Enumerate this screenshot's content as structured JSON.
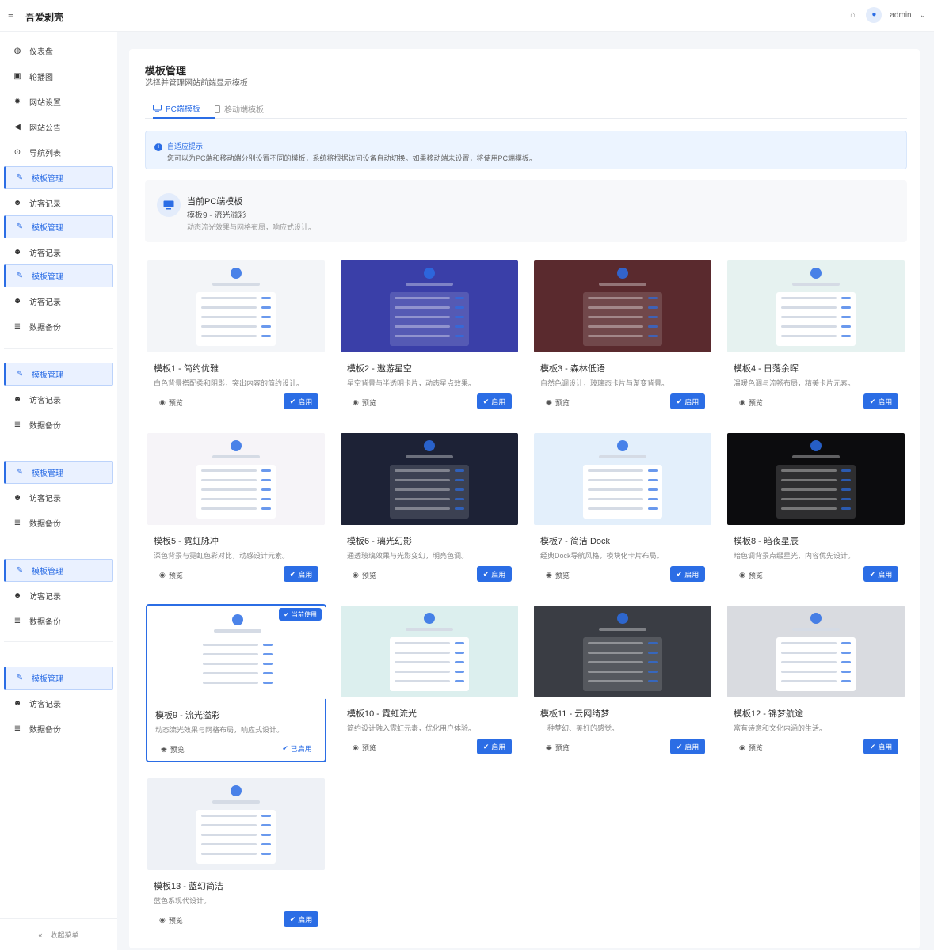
{
  "header": {
    "brand": "吾爱剥壳",
    "username": "admin",
    "caret": "⌄",
    "menu_icon": "menu-icon",
    "home_icon": "home-icon",
    "avatar_icon": "user-icon"
  },
  "sidebar": {
    "items": [
      {
        "label": "仪表盘",
        "icon": "dashboard-icon",
        "glyph": "◍",
        "active": false
      },
      {
        "label": "轮播图",
        "icon": "image-icon",
        "glyph": "▣",
        "active": false
      },
      {
        "label": "网站设置",
        "icon": "gear-icon",
        "glyph": "✹",
        "active": false
      },
      {
        "label": "网站公告",
        "icon": "megaphone-icon",
        "glyph": "◀",
        "active": false
      },
      {
        "label": "导航列表",
        "icon": "compass-icon",
        "glyph": "⊙",
        "active": false
      },
      {
        "label": "模板管理",
        "icon": "brush-icon",
        "glyph": "✎",
        "active": true
      },
      {
        "label": "访客记录",
        "icon": "users-icon",
        "glyph": "☻",
        "active": false
      },
      {
        "label": "模板管理",
        "icon": "brush-icon",
        "glyph": "✎",
        "active": true
      },
      {
        "label": "访客记录",
        "icon": "users-icon",
        "glyph": "☻",
        "active": false
      },
      {
        "label": "模板管理",
        "icon": "brush-icon",
        "glyph": "✎",
        "active": true
      },
      {
        "label": "访客记录",
        "icon": "users-icon",
        "glyph": "☻",
        "active": false
      },
      {
        "label": "数据备份",
        "icon": "database-icon",
        "glyph": "≣",
        "active": false
      },
      {
        "label": "模板管理",
        "icon": "brush-icon",
        "glyph": "✎",
        "active": true
      },
      {
        "label": "访客记录",
        "icon": "users-icon",
        "glyph": "☻",
        "active": false
      },
      {
        "label": "数据备份",
        "icon": "database-icon",
        "glyph": "≣",
        "active": false
      },
      {
        "label": "模板管理",
        "icon": "brush-icon",
        "glyph": "✎",
        "active": true
      },
      {
        "label": "访客记录",
        "icon": "users-icon",
        "glyph": "☻",
        "active": false
      },
      {
        "label": "数据备份",
        "icon": "database-icon",
        "glyph": "≣",
        "active": false
      },
      {
        "label": "模板管理",
        "icon": "brush-icon",
        "glyph": "✎",
        "active": true
      },
      {
        "label": "访客记录",
        "icon": "users-icon",
        "glyph": "☻",
        "active": false
      },
      {
        "label": "数据备份",
        "icon": "database-icon",
        "glyph": "≣",
        "active": false
      },
      {
        "label": "模板管理",
        "icon": "brush-icon",
        "glyph": "✎",
        "active": true
      },
      {
        "label": "访客记录",
        "icon": "users-icon",
        "glyph": "☻",
        "active": false
      },
      {
        "label": "数据备份",
        "icon": "database-icon",
        "glyph": "≣",
        "active": false
      }
    ],
    "collapse_icon": "«",
    "collapse_label": "收起菜单"
  },
  "page": {
    "title": "模板管理",
    "subtitle": "选择并管理网站前端显示模板"
  },
  "tabs": {
    "pc": "PC端模板",
    "mobile": "移动端模板"
  },
  "info": {
    "title": "自适应提示",
    "text": "您可以为PC端和移动端分别设置不同的模板，系统将根据访问设备自动切换。如果移动端未设置，将使用PC端模板。"
  },
  "current": {
    "label": "当前PC端模板",
    "name": "模板9 - 流光溢彩",
    "desc": "动态流光效果与网格布局，响应式设计。"
  },
  "card_labels": {
    "preview": "预览",
    "enable": "启用",
    "enabled": "已启用",
    "current_badge": "当前使用"
  },
  "templates": [
    {
      "title": "模板1 - 简约优雅",
      "desc": "白色背景搭配柔和阴影，突出内容的简约设计。",
      "theme": "#f3f5f8",
      "current": false
    },
    {
      "title": "模板2 - 遨游星空",
      "desc": "星空背景与半透明卡片，动态星点效果。",
      "theme": "#3a3fa8",
      "current": false
    },
    {
      "title": "模板3 - 森林低语",
      "desc": "自然色调设计，玻璃态卡片与渐变背景。",
      "theme": "#5a2a2e",
      "current": false
    },
    {
      "title": "模板4 - 日落余晖",
      "desc": "温暖色调与流畅布局，精美卡片元素。",
      "theme": "#e6f2f0",
      "current": false
    },
    {
      "title": "模板5 - 霓虹脉冲",
      "desc": "深色背景与霓虹色彩对比，动感设计元素。",
      "theme": "#f6f4f8",
      "current": false
    },
    {
      "title": "模板6 - 璃光幻影",
      "desc": "通透玻璃效果与光影变幻，明亮色调。",
      "theme": "#1d2236",
      "current": false
    },
    {
      "title": "模板7 - 简洁 Dock",
      "desc": "经典Dock导航风格，模块化卡片布局。",
      "theme": "#e3effb",
      "current": false
    },
    {
      "title": "模板8 - 暗夜星辰",
      "desc": "暗色调背景点缀星光，内容优先设计。",
      "theme": "#0c0c0e",
      "current": false
    },
    {
      "title": "模板9 - 流光溢彩",
      "desc": "动态流光效果与网格布局，响应式设计。",
      "theme": "#ffffff",
      "current": true
    },
    {
      "title": "模板10 - 霓虹流光",
      "desc": "简约设计融入霓虹元素，优化用户体验。",
      "theme": "#dcefee",
      "current": false
    },
    {
      "title": "模板11 - 云网绮梦",
      "desc": "一种梦幻、美好的感觉。",
      "theme": "#3a3d44",
      "current": false
    },
    {
      "title": "模板12 - 锦梦航途",
      "desc": "富有诗意和文化内涵的生活。",
      "theme": "#d9dbe0",
      "current": false
    },
    {
      "title": "模板13 - 蓝幻简洁",
      "desc": "蓝色系现代设计。",
      "theme": "#eef1f6",
      "current": false
    }
  ],
  "colors": {
    "accent": "#2b6de5"
  }
}
